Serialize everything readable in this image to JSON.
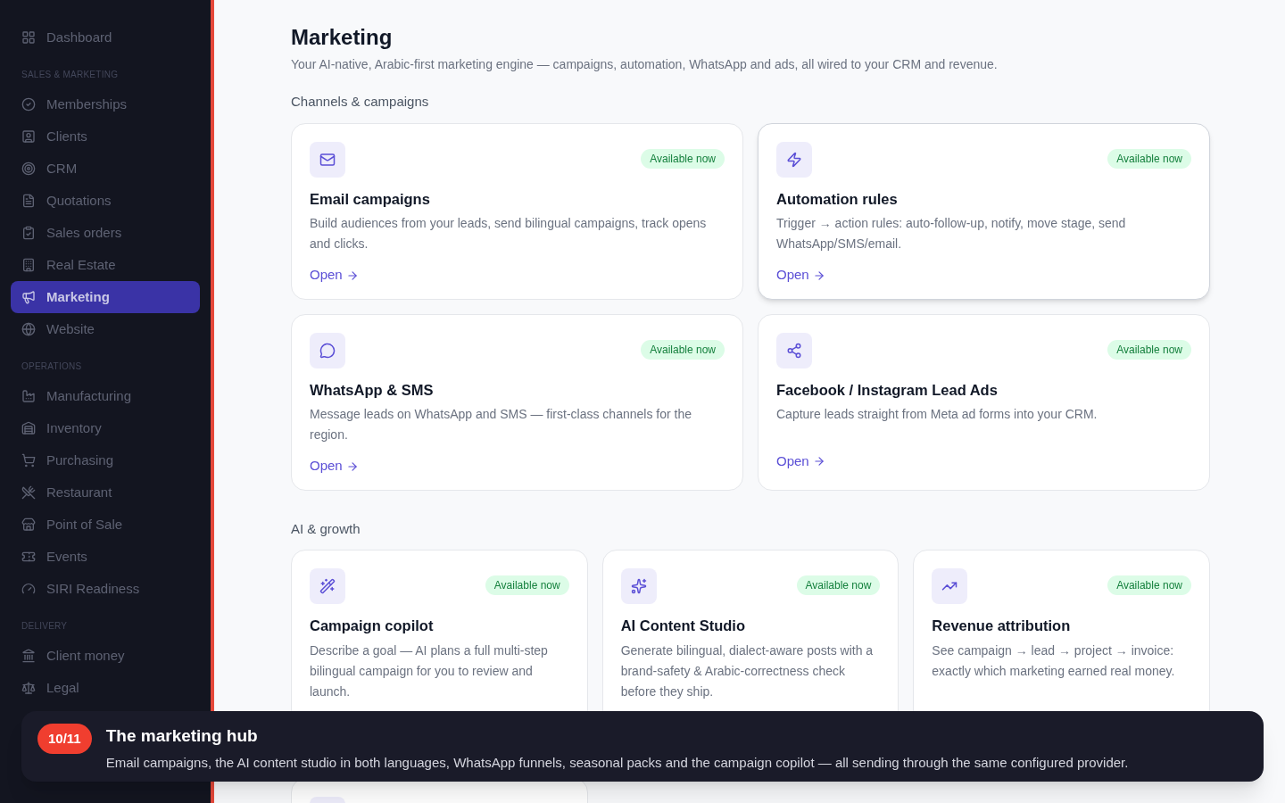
{
  "sidebar": {
    "sections": [
      {
        "items": [
          {
            "label": "Dashboard",
            "selected": false
          }
        ]
      },
      {
        "title": "SALES & MARKETING",
        "items": [
          {
            "label": "Memberships",
            "selected": false
          },
          {
            "label": "Clients",
            "selected": false
          },
          {
            "label": "CRM",
            "selected": false
          },
          {
            "label": "Quotations",
            "selected": false
          },
          {
            "label": "Sales orders",
            "selected": false
          },
          {
            "label": "Real Estate",
            "selected": false
          },
          {
            "label": "Marketing",
            "selected": true
          },
          {
            "label": "Website",
            "selected": false
          }
        ]
      },
      {
        "title": "OPERATIONS",
        "items": [
          {
            "label": "Manufacturing",
            "selected": false
          },
          {
            "label": "Inventory",
            "selected": false
          },
          {
            "label": "Purchasing",
            "selected": false
          },
          {
            "label": "Restaurant",
            "selected": false
          },
          {
            "label": "Point of Sale",
            "selected": false
          },
          {
            "label": "Events",
            "selected": false
          },
          {
            "label": "SIRI Readiness",
            "selected": false
          }
        ]
      },
      {
        "title": "DELIVERY",
        "items": [
          {
            "label": "Client money",
            "selected": false
          },
          {
            "label": "Legal",
            "selected": false
          }
        ]
      }
    ]
  },
  "page": {
    "title": "Marketing",
    "subtitle": "Your AI-native, Arabic-first marketing engine — campaigns, automation, WhatsApp and ads, all wired to your CRM and revenue.",
    "groups": [
      {
        "title": "Channels & campaigns",
        "cards": [
          {
            "title": "Email campaigns",
            "badge": "Available now",
            "description": "Build audiences from your leads, send bilingual campaigns, track opens and clicks.",
            "link": "Open",
            "highlighted": false
          },
          {
            "title": "Automation rules",
            "badge": "Available now",
            "description": "Trigger → action rules: auto-follow-up, notify, move stage, send WhatsApp/SMS/email.",
            "link": "Open",
            "highlighted": true
          },
          {
            "title": "WhatsApp & SMS",
            "badge": "Available now",
            "description": "Message leads on WhatsApp and SMS — first-class channels for the region.",
            "link": "Open",
            "highlighted": false
          },
          {
            "title": "Facebook / Instagram Lead Ads",
            "badge": "Available now",
            "description": "Capture leads straight from Meta ad forms into your CRM.",
            "link": "Open",
            "highlighted": false
          }
        ]
      },
      {
        "title": "AI & growth",
        "cards": [
          {
            "title": "Campaign copilot",
            "badge": "Available now",
            "description": "Describe a goal — AI plans a full multi-step bilingual campaign for you to review and launch.",
            "highlighted": false
          },
          {
            "title": "AI Content Studio",
            "badge": "Available now",
            "description": "Generate bilingual, dialect-aware posts with a brand-safety & Arabic-correctness check before they ship.",
            "highlighted": false
          },
          {
            "title": "Revenue attribution",
            "badge": "Available now",
            "description": "See campaign → lead → project → invoice: exactly which marketing earned real money.",
            "highlighted": false
          },
          {
            "highlighted": false
          }
        ]
      }
    ]
  },
  "tour": {
    "step": "10/11",
    "title": "The marketing hub",
    "text": "Email campaigns, the AI content studio in both languages, WhatsApp funnels, seasonal packs and the campaign copilot — all sending through the same configured provider."
  }
}
